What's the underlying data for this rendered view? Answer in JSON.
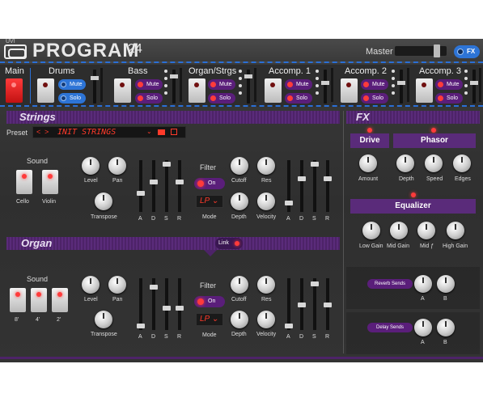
{
  "header": {
    "brand": "UVI",
    "title": "PROGRAM",
    "number": "24",
    "master_label": "Master",
    "fx_label": "FX",
    "master_level": 0.85
  },
  "parts": [
    {
      "name": "Main",
      "active": true
    },
    {
      "name": "Drums",
      "mute": "Mute",
      "solo": "Solo"
    },
    {
      "name": "Bass",
      "mute": "Mute",
      "solo": "Solo"
    },
    {
      "name": "Organ/Strgs",
      "mute": "Mute",
      "solo": "Solo"
    },
    {
      "name": "Accomp. 1",
      "mute": "Mute",
      "solo": "Solo"
    },
    {
      "name": "Accomp. 2",
      "mute": "Mute",
      "solo": "Solo"
    },
    {
      "name": "Accomp. 3",
      "mute": "Mute",
      "solo": "Solo"
    }
  ],
  "strings": {
    "title": "Strings",
    "preset_label": "Preset",
    "preset_value": "INIT STRINGS",
    "sound_label": "Sound",
    "sounds": [
      "Cello",
      "Violin"
    ],
    "knobs": {
      "level": "Level",
      "pan": "Pan",
      "transpose": "Transpose"
    },
    "adsr": [
      "A",
      "D",
      "S",
      "R"
    ],
    "filter_label": "Filter",
    "filter_on": "On",
    "mode_value": "LP",
    "mode_label": "Mode",
    "cutoff": "Cutoff",
    "res": "Res",
    "depth": "Depth",
    "velocity": "Velocity"
  },
  "organ": {
    "title": "Organ",
    "link_label": "Link",
    "sound_label": "Sound",
    "sounds": [
      "8'",
      "4'",
      "2'"
    ],
    "knobs": {
      "level": "Level",
      "pan": "Pan",
      "transpose": "Transpose"
    },
    "adsr": [
      "A",
      "D",
      "S",
      "R"
    ],
    "filter_label": "Filter",
    "filter_on": "On",
    "mode_value": "LP",
    "mode_label": "Mode",
    "cutoff": "Cutoff",
    "res": "Res",
    "depth": "Depth",
    "velocity": "Velocity"
  },
  "fx": {
    "title": "FX",
    "drive": {
      "label": "Drive",
      "amount": "Amount"
    },
    "phasor": {
      "label": "Phasor",
      "depth": "Depth",
      "speed": "Speed",
      "edges": "Edges"
    },
    "equalizer": {
      "label": "Equalizer",
      "low": "Low Gain",
      "mid": "Mid Gain",
      "midf": "Mid ƒ",
      "high": "High Gain"
    },
    "reverb": {
      "label": "Reverb Sends",
      "a": "A",
      "b": "B"
    },
    "delay": {
      "label": "Delay Sends",
      "a": "A",
      "b": "B"
    }
  }
}
